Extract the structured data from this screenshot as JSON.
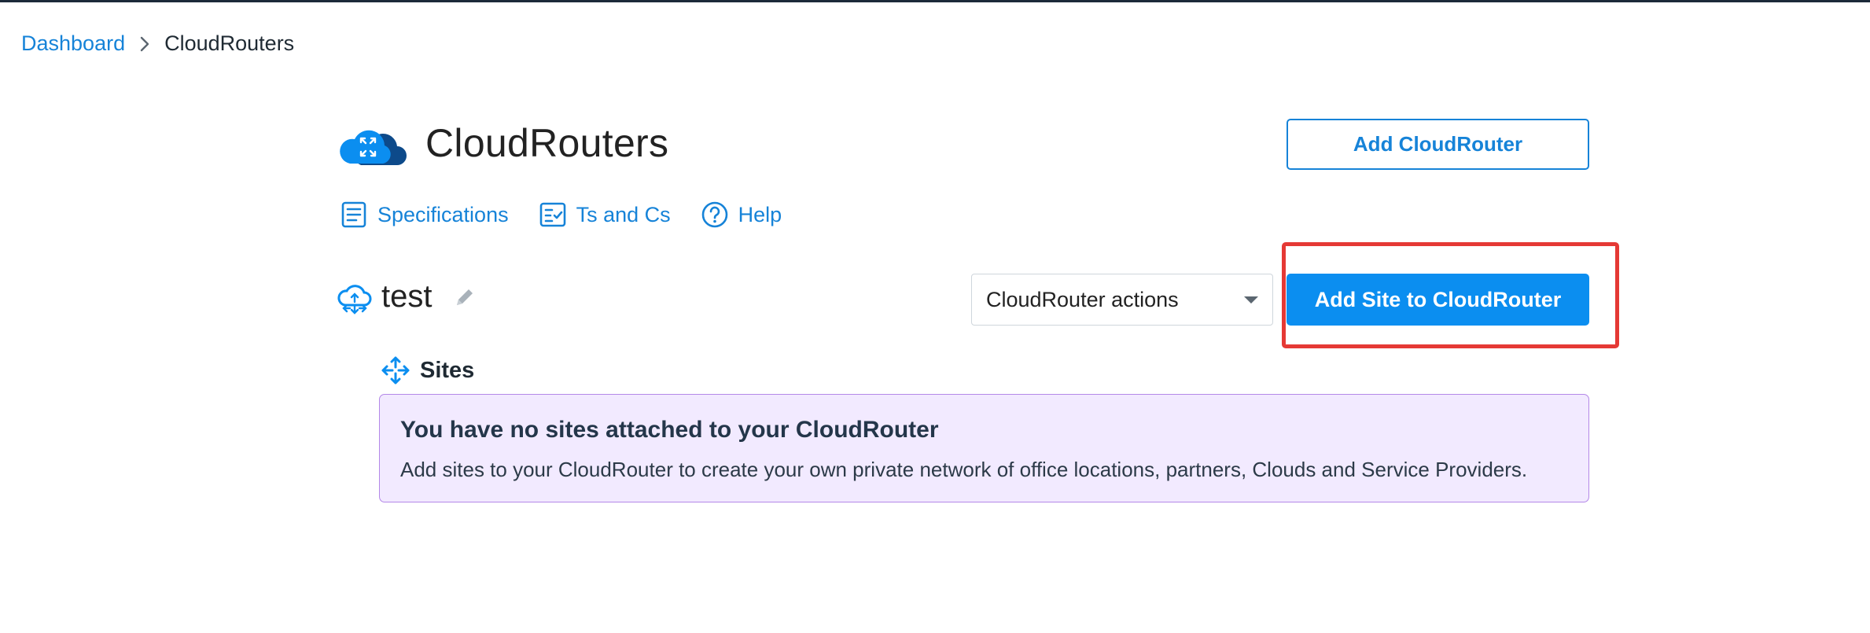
{
  "breadcrumb": {
    "root": "Dashboard",
    "current": "CloudRouters"
  },
  "header": {
    "title": "CloudRouters",
    "add_button": "Add CloudRouter"
  },
  "links": {
    "specifications": "Specifications",
    "terms": "Ts and Cs",
    "help": "Help"
  },
  "router": {
    "name": "test",
    "actions_select": "CloudRouter actions",
    "add_site_button": "Add Site to CloudRouter"
  },
  "sites": {
    "title": "Sites",
    "empty_title": "You have no sites attached to your CloudRouter",
    "empty_text": "Add sites to your CloudRouter to create your own private network of office locations, partners, Clouds and Service Providers."
  },
  "icons": {
    "breadcrumb_sep": "chevron-right-icon",
    "logo": "cloudrouter-logo-icon",
    "specifications": "document-icon",
    "terms": "checklist-icon",
    "help": "help-circle-icon",
    "router": "cloud-router-icon",
    "edit": "pencil-icon",
    "sites": "sites-arrows-icon",
    "select_caret": "caret-down-icon"
  },
  "colors": {
    "accent": "#1683d8",
    "primary_button": "#0b8ef0",
    "highlight": "#e53935",
    "notice_bg": "#f2eaff",
    "notice_border": "#b488e8"
  }
}
